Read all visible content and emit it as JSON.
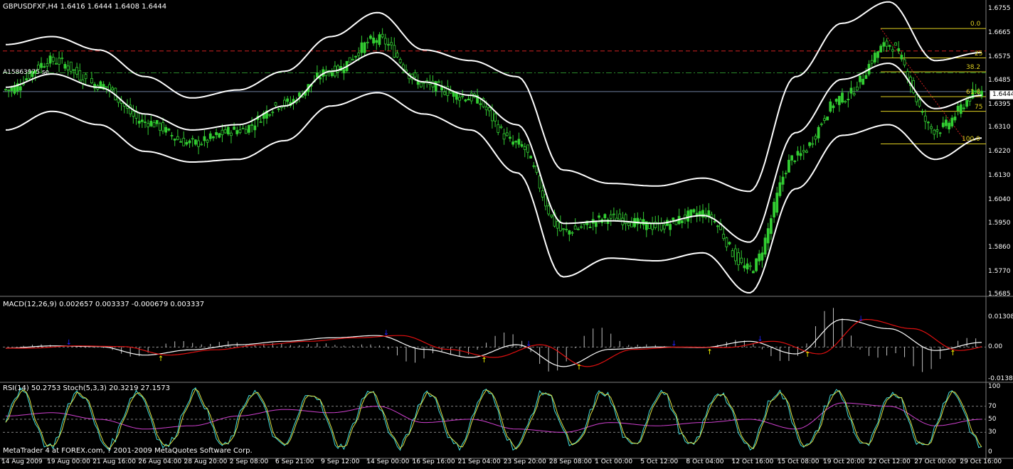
{
  "colors": {
    "background": "#000000",
    "candle": "#32cd32",
    "band": "#ffffff",
    "resistance": "#d02020",
    "midline": "#2a8a2a",
    "fib": "#e0d020",
    "macd_signal": "#e01010",
    "rsi": "#d040d0",
    "stoch_main": "#40e0e0",
    "stoch_signal": "#e0e040",
    "arrow_up": "#ffff00",
    "arrow_down": "#2020ff"
  },
  "main": {
    "header": "GBPUSDFXF,H4  1.6416 1.6444 1.6408 1.6444",
    "left_note": "A15863975 se",
    "current_price": "1.6444",
    "price_axis": [
      "1.6755",
      "1.6665",
      "1.6575",
      "1.6485",
      "1.6395",
      "1.6310",
      "1.6220",
      "1.6130",
      "1.6040",
      "1.5950",
      "1.5860",
      "1.5770",
      "1.5685"
    ],
    "fib_levels": [
      {
        "label": "0.0",
        "value": 1.668
      },
      {
        "label": "25",
        "value": 1.657
      },
      {
        "label": "38.2",
        "value": 1.6518
      },
      {
        "label": "61.8",
        "value": 1.6425
      },
      {
        "label": "75",
        "value": 1.637
      },
      {
        "label": "100.0",
        "value": 1.6248
      }
    ]
  },
  "macd": {
    "header": "MACD(12,26,9) 0.002657 0.003337 -0.000679 0.003337",
    "axis": [
      "0.013089",
      "0.00",
      "-0.01380"
    ]
  },
  "rsi": {
    "header": "RSI(14) 50.2753  Stoch(5,3,3) 20.3219 27.1573",
    "axis": [
      "100",
      "70",
      "50",
      "30",
      "0"
    ],
    "footer": "MetaTrader 4 at FOREX.com, ? 2001-2009 MetaQuotes Software Corp."
  },
  "dates": [
    "14 Aug 2009",
    "19 Aug 00:00",
    "21 Aug 16:00",
    "26 Aug 04:00",
    "28 Aug 20:00",
    "2 Sep 08:00",
    "6 Sep 21:00",
    "9 Sep 12:00",
    "14 Sep 00:00",
    "16 Sep 16:00",
    "21 Sep 04:00",
    "23 Sep 20:00",
    "28 Sep 08:00",
    "1 Oct 00:00",
    "5 Oct 12:00",
    "8 Oct 04:00",
    "12 Oct 16:00",
    "15 Oct 08:00",
    "19 Oct 20:00",
    "22 Oct 12:00",
    "27 Oct 00:00",
    "29 Oct 16:00"
  ],
  "chart_data": {
    "type": "line",
    "symbol": "GBPUSDFXF",
    "timeframe": "H4",
    "ylim": [
      1.5685,
      1.6755
    ],
    "x": [
      "14 Aug 2009",
      "19 Aug 00:00",
      "21 Aug 16:00",
      "26 Aug 04:00",
      "28 Aug 20:00",
      "2 Sep 08:00",
      "6 Sep 21:00",
      "9 Sep 12:00",
      "14 Sep 00:00",
      "16 Sep 16:00",
      "21 Sep 04:00",
      "23 Sep 20:00",
      "28 Sep 08:00",
      "1 Oct 00:00",
      "5 Oct 12:00",
      "8 Oct 04:00",
      "12 Oct 16:00",
      "15 Oct 08:00",
      "19 Oct 20:00",
      "22 Oct 12:00",
      "27 Oct 00:00",
      "29 Oct 16:00"
    ],
    "close": [
      1.645,
      1.656,
      1.647,
      1.633,
      1.625,
      1.63,
      1.64,
      1.652,
      1.664,
      1.647,
      1.642,
      1.625,
      1.592,
      1.597,
      1.594,
      1.599,
      1.578,
      1.62,
      1.642,
      1.662,
      1.63,
      1.6444
    ],
    "bb_upper": [
      1.662,
      1.665,
      1.66,
      1.65,
      1.642,
      1.645,
      1.652,
      1.665,
      1.674,
      1.66,
      1.656,
      1.65,
      1.615,
      1.61,
      1.609,
      1.612,
      1.607,
      1.65,
      1.67,
      1.678,
      1.656,
      1.659
    ],
    "bb_mid": [
      1.646,
      1.651,
      1.646,
      1.636,
      1.63,
      1.632,
      1.639,
      1.652,
      1.659,
      1.648,
      1.643,
      1.632,
      1.595,
      1.596,
      1.595,
      1.598,
      1.588,
      1.629,
      1.649,
      1.655,
      1.638,
      1.643
    ],
    "bb_lower": [
      1.63,
      1.637,
      1.632,
      1.622,
      1.618,
      1.619,
      1.626,
      1.639,
      1.644,
      1.636,
      1.63,
      1.614,
      1.575,
      1.582,
      1.581,
      1.584,
      1.569,
      1.608,
      1.628,
      1.632,
      1.619,
      1.627
    ],
    "macd": [
      -0.0005,
      0.0005,
      0.0002,
      -0.0035,
      -0.0012,
      0.001,
      0.0025,
      0.004,
      0.005,
      -0.001,
      -0.0045,
      0.001,
      -0.0085,
      -0.001,
      0.0,
      -0.0002,
      0.0025,
      -0.003,
      0.012,
      0.008,
      -0.0015,
      0.002
    ],
    "rsi": [
      55,
      60,
      50,
      35,
      40,
      55,
      65,
      60,
      70,
      45,
      50,
      35,
      30,
      45,
      40,
      45,
      50,
      35,
      75,
      70,
      40,
      50
    ]
  }
}
